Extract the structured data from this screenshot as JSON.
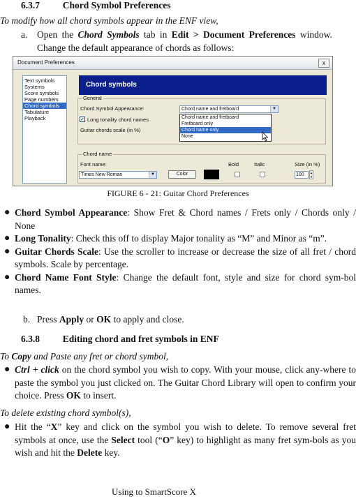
{
  "section_1": {
    "number": "6.3.7",
    "title": "Chord Symbol Preferences"
  },
  "intro": "To modify how all chord symbols appear in the ENF view,",
  "step_a": {
    "marker": "a.",
    "t1": "Open the ",
    "b1": "Chord Symbols",
    "t2": " tab in ",
    "b2": "Edit > Document Preferences",
    "t3": " window.",
    "line2": "Change the default appearance of chords as follows:"
  },
  "dialog": {
    "title": "Document Preferences",
    "close": "x",
    "nav_items": [
      "Text symbols",
      "Systems",
      "Score symbols",
      "Page numbers",
      "Chord symbols",
      "Tabulature",
      "Playback"
    ],
    "nav_selected": "Chord symbols",
    "banner": "Chord symbols",
    "general_group": "General",
    "appearance_label": "Chord Symbol Appearance:",
    "appearance_value": "Chord name and fretboard",
    "dropdown_options": [
      "Chord name and fretboard",
      "Fretboard only",
      "Chord name only",
      "None"
    ],
    "dropdown_highlight": "Chord name only",
    "long_tonality_label": "Long tonality chord names",
    "long_tonality_checked": true,
    "scale_label": "Guitar chords scale (in %)",
    "chordname_group": "Chord name",
    "font_name_label": "Font name:",
    "bold_label": "Bold",
    "italic_label": "Italic",
    "size_label": "Size (in %)",
    "font_value": "Times New Roman",
    "color_button": "Color",
    "size_value": "100"
  },
  "figure_caption": "FIGURE 6 - 21: Guitar Chord Preferences",
  "bullets": [
    {
      "bold": "Chord Symbol Appearance",
      "text": ": Show Fret & Chord names / Frets only / Chords only / None"
    },
    {
      "bold": "Long Tonality",
      "text": ": Check this off to display Major tonality as “M” and Minor as “m”."
    },
    {
      "bold": "Guitar Chords Scale",
      "text": ": Use the scroller to increase or decrease the size of all fret / chord symbols. Scale by percentage."
    },
    {
      "bold": "Chord Name Font Style",
      "text": ": Change the default font, style and size for chord sym-bol names."
    }
  ],
  "step_b": {
    "marker": "b.",
    "t1": "Press ",
    "b1": "Apply",
    "t2": " or ",
    "b2": "OK",
    "t3": " to apply and close."
  },
  "section_2": {
    "number": "6.3.8",
    "title": "Editing chord and fret symbols in ENF"
  },
  "copy_intro": {
    "t1": "To ",
    "b1": "Copy",
    "t2": " and Paste any fret or chord symbol,"
  },
  "copy_bullet": {
    "b1": "Ctrl + click",
    "t1": " on the chord symbol you wish to copy. With your mouse, click any-where to paste the symbol you just clicked on. The Guitar Chord Library will open to confirm your choice. Press ",
    "b2": "OK",
    "t2": " to insert."
  },
  "delete_intro": "To delete existing chord symbol(s),",
  "delete_bullet": {
    "t1": "Hit the “",
    "b1": "X",
    "t2": "” key and click on the symbol you wish to delete. To remove several fret symbols at once, use the ",
    "b2": "Select",
    "t3": " tool (“",
    "b3": "O",
    "t4": "” key) to highlight as many fret sym-bols as you wish and hit the ",
    "b4": "Delete",
    "t5": " key."
  },
  "footer": "Using to SmartScore X"
}
